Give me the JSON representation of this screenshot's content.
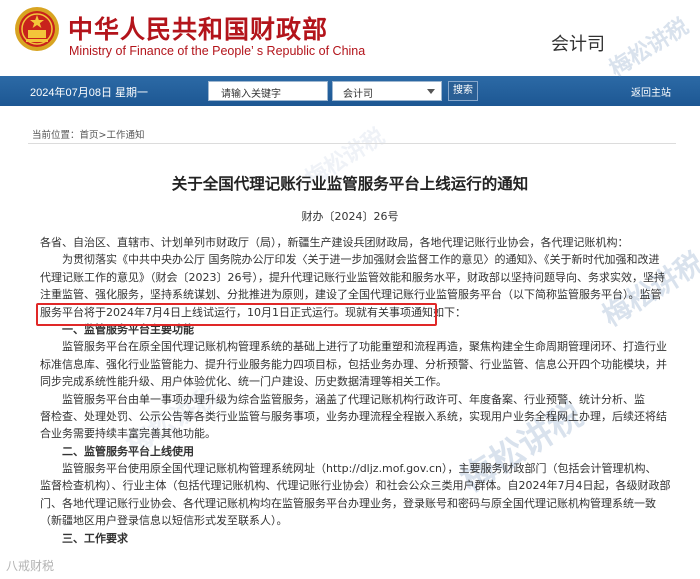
{
  "header": {
    "cn_title": "中华人民共和国财政部",
    "en_title": "Ministry of Finance of the People’ s Republic of China",
    "department": "会计司",
    "emblem_icon": "national-emblem-icon"
  },
  "topbar": {
    "date": "2024年07月08日  星期一",
    "search_placeholder": "请输入关键字",
    "select_value": "会计司",
    "search_label": "搜索",
    "back_home_label": "返回主站",
    "bar_color": "#1d5793"
  },
  "breadcrumb": {
    "prefix": "当前位置：",
    "home": "首页",
    "separator": ">",
    "current": "工作通知"
  },
  "article": {
    "title": "关于全国代理记账行业监管服务平台上线运行的通知",
    "doc_number": "财办〔2024〕26号",
    "lines": [
      "各省、自治区、直辖市、计划单列市财政厅（局），新疆生产建设兵团财政局，各地代理记账行业协会，各代理记账机构：",
      "　　为贯彻落实《中共中央办公厅 国务院办公厅印发〈关于进一步加强财会监督工作的意见〉的通知》、《关于新时代加强和改进",
      "代理记账工作的意见》（财会〔2023〕26号），提升代理记账行业监管效能和服务水平，财政部以坚持问题导向、务求实效，坚持",
      "注重监管、强化服务，坚持系统谋划、分批推进为原则，建设了全国代理记账行业监管服务平台（以下简称监管服务平台）。监管",
      "服务平台将于2024年7月4日上线试运行，10月1日正式运行。现就有关事项通知如下：",
      "　　一、监管服务平台主要功能",
      "　　监管服务平台在原全国代理记账机构管理系统的基础上进行了功能重塑和流程再造，聚焦构建全生命周期管理闭环、打造行业",
      "标准信息库、强化行业监管能力、提升行业服务能力四项目标，包括业务办理、分析预警、行业监管、信息公开四个功能模块，并",
      "同步完成系统性能升级、用户体验优化、统一门户建设、历史数据清理等相关工作。",
      "　　监管服务平台由单一事项办理升级为综合监管服务，涵盖了代理记账机构行政许可、年度备案、行业预警、统计分析、监",
      "督检查、处理处罚、公示公告等各类行业监管与服务事项，业务办理流程全程嵌入系统，实现用户业务全程网上办理，后续还将结",
      "合业务需要持续丰富完善其他功能。",
      "　　二、监管服务平台上线使用",
      "　　监管服务平台使用原全国代理记账机构管理系统网址（http://dljz.mof.gov.cn），主要服务财政部门（包括会计管理机构、",
      "监督检查机构）、行业主体（包括代理记账机构、代理记账行业协会）和社会公众三类用户群体。自2024年7月4日起，各级财政部",
      "门、各地代理记账行业协会、各代理记账机构均在监管服务平台办理业务，登录账号和密码与原全国代理记账机构管理系统一致",
      "（新疆地区用户登录信息以短信形式发至联系人）。",
      "　　三、工作要求"
    ]
  },
  "watermarks": [
    "梅松讲税",
    "梅松讲税",
    "梅松讲税",
    "梅松讲税",
    "梅松讲税"
  ],
  "footer_watermark": "八戒财税"
}
